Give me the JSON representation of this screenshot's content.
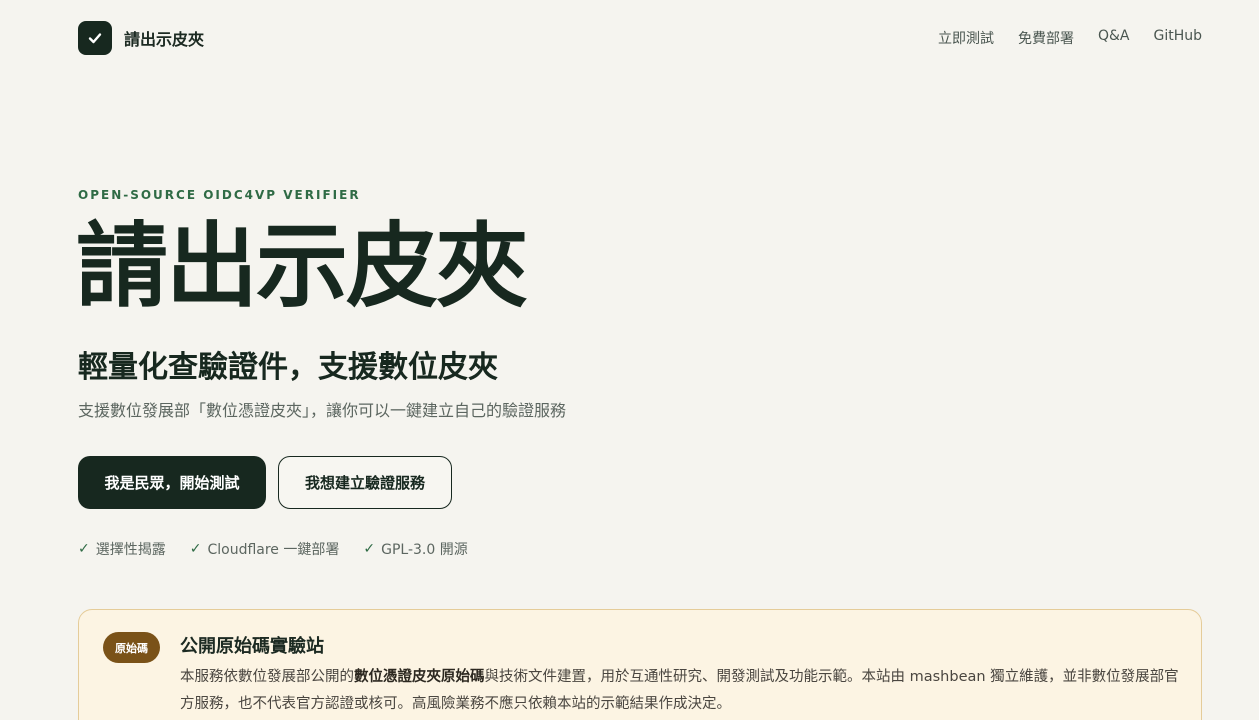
{
  "header": {
    "brand_name": "請出示皮夾",
    "nav": [
      "立即測試",
      "免費部署",
      "Q&A",
      "GitHub"
    ]
  },
  "hero": {
    "eyebrow": "OPEN-SOURCE OIDC4VP VERIFIER",
    "title": "請出示皮夾",
    "subtitle": "輕量化查驗證件，支援數位皮夾",
    "description": "支援數位發展部「數位憑證皮夾」，讓你可以一鍵建立自己的驗證服務",
    "primary_button": "我是民眾，開始測試",
    "secondary_button": "我想建立驗證服務",
    "features": [
      "選擇性揭露",
      "Cloudflare 一鍵部署",
      "GPL-3.0 開源"
    ]
  },
  "notice": {
    "badge": "原始碼",
    "title": "公開原始碼實驗站",
    "body_prefix": "本服務依數位發展部公開的",
    "body_bold": "數位憑證皮夾原始碼",
    "body_suffix": "與技術文件建置，用於互通性研究、開發測試及功能示範。本站由 mashbean 獨立維護，並非數位發展部官方服務，也不代表官方認證或核可。高風險業務不應只依賴本站的示範結果作成決定。"
  },
  "colors": {
    "background": "#f5f4ef",
    "primary": "#17281f",
    "accent_green": "#2f6b45",
    "notice_bg": "#fcf4e3",
    "badge_brown": "#7a5218"
  },
  "icons": {
    "logo": "check-icon",
    "feature": "check-icon"
  }
}
